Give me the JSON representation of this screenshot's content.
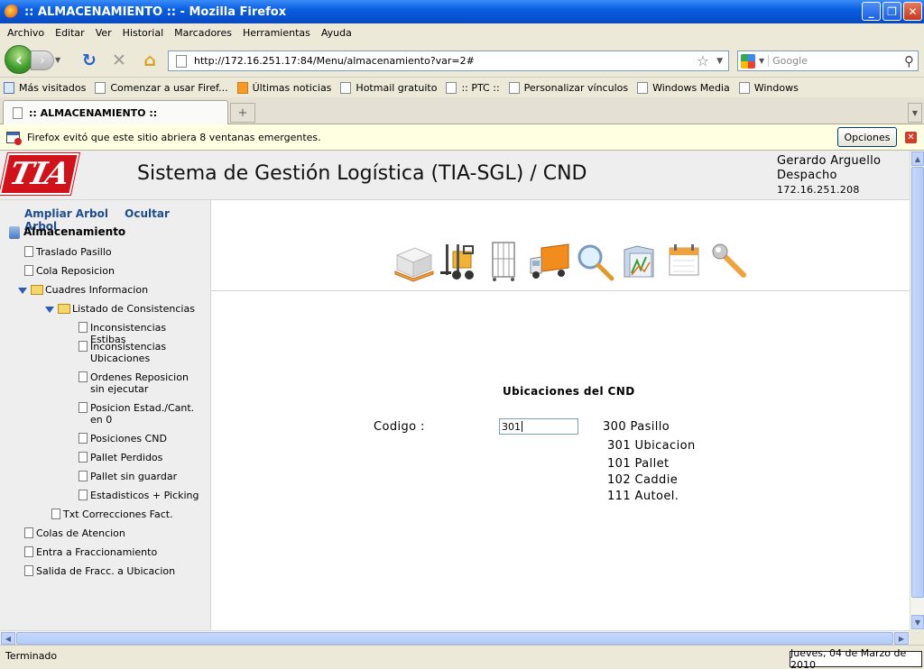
{
  "window": {
    "title": ":: ALMACENAMIENTO :: - Mozilla Firefox"
  },
  "menu": [
    "Archivo",
    "Editar",
    "Ver",
    "Historial",
    "Marcadores",
    "Herramientas",
    "Ayuda"
  ],
  "nav": {
    "url": "http://172.16.251.17:84/Menu/almacenamiento?var=2#",
    "search_placeholder": "Google"
  },
  "bookmarks": [
    "Más visitados",
    "Comenzar a usar Firef...",
    "Últimas noticias",
    "Hotmail gratuito",
    ":: PTC ::",
    "Personalizar vínculos",
    "Windows Media",
    "Windows"
  ],
  "tab": {
    "title": ":: ALMACENAMIENTO ::"
  },
  "notification": {
    "message": "Firefox evitó que este sitio abriera 8 ventanas emergentes.",
    "options_label": "Opciones"
  },
  "page": {
    "logo_text": "TIA",
    "system_title": "Sistema de Gestión Logística (TIA-SGL) / CND",
    "user": {
      "name": "Gerardo Arguello",
      "role": "Despacho",
      "ip": "172.16.251.208"
    }
  },
  "sidebar": {
    "expand_label": "Ampliar Arbol",
    "hide_label": "Ocultar Arbol",
    "root": "Almacenamiento",
    "items": {
      "traslado": "Traslado Pasillo",
      "cola": "Cola Reposicion",
      "cuadros": "Cuadres Informacion",
      "listado": "Listado de Consistencias",
      "inc_estibas": "Inconsistencias Estibas",
      "inc_ubic": "Inconsistencias Ubicaciones",
      "ordenes": "Ordenes Reposicion sin ejecutar",
      "posicion_estad": "Posicion Estad./Cant. en 0",
      "posiciones_cnd": "Posiciones CND",
      "pallet_perdidos": "Pallet Perdidos",
      "pallet_sin": "Pallet sin guardar",
      "estadisticos": "Estadisticos + Picking",
      "txt_correcciones": "Txt Correcciones Fact.",
      "colas_atencion": "Colas de Atencion",
      "entra_fracc": "Entra a Fraccionamiento",
      "salida_fracc": "Salida de Fracc. a Ubicacion"
    }
  },
  "main": {
    "section_title": "Ubicaciones del CND",
    "codigo_label": "Codigo :",
    "codigo_value": "301",
    "legend": [
      "300 Pasillo",
      "301 Ubicacion",
      "101 Pallet",
      "102 Caddie",
      "111 Autoel."
    ]
  },
  "status": {
    "text": "Terminado",
    "date": "Jueves, 04 de Marzo de 2010"
  },
  "colors": {
    "brand_red": "#d2121b",
    "link_blue": "#1f4d8c",
    "titlebar_blue": "#0a5fe0"
  }
}
